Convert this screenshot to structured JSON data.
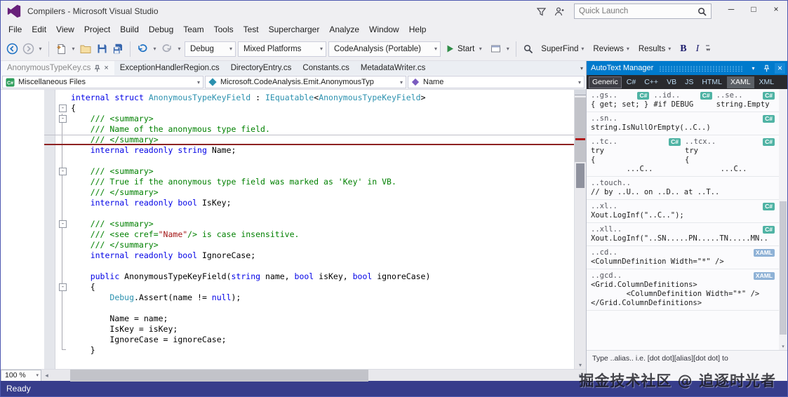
{
  "window": {
    "title": "Compilers - Microsoft Visual Studio"
  },
  "titlebar": {
    "quick_launch_placeholder": "Quick Launch",
    "minimize": "─",
    "maximize": "□",
    "close": "×"
  },
  "icons": {
    "dropdown": "▾",
    "scroll_left": "◂",
    "scroll_right": "▸",
    "scroll_down": "▾",
    "fold_collapse": "-",
    "tab_close": "×",
    "panel_close": "×",
    "window_menu": "▾",
    "overflow": "▾▾"
  },
  "colors": {
    "panel_header": "#007ACC",
    "status_bar": "#373D8B",
    "keyword": "#0000E6",
    "type": "#2B91AF",
    "comment": "#008000",
    "string": "#A31515",
    "badge_csharp": "#4FB3A4",
    "badge_xaml": "#8FB2D6"
  },
  "menubar": {
    "items": [
      "File",
      "Edit",
      "View",
      "Project",
      "Build",
      "Debug",
      "Team",
      "Tools",
      "Test",
      "Supercharger",
      "Analyze",
      "Window",
      "Help"
    ]
  },
  "toolbar": {
    "debug_combo": "Debug",
    "platform_combo": "Mixed Platforms",
    "config_combo": "CodeAnalysis (Portable)",
    "start_label": "Start",
    "superfind_label": "SuperFind",
    "reviews_label": "Reviews",
    "results_label": "Results",
    "bold_label": "B",
    "italic_label": "I"
  },
  "tabbar": {
    "tabs": [
      {
        "label": "AnonymousTypeKey.cs",
        "active": true
      },
      {
        "label": "ExceptionHandlerRegion.cs",
        "active": false
      },
      {
        "label": "DirectoryEntry.cs",
        "active": false
      },
      {
        "label": "Constants.cs",
        "active": false
      },
      {
        "label": "MetadataWriter.cs",
        "active": false
      }
    ]
  },
  "navbar": {
    "project": "Miscellaneous Files",
    "type": "Microsoft.CodeAnalysis.Emit.AnonymousTyp",
    "member": "Name"
  },
  "editor": {
    "zoom": "100 %",
    "lines": [
      {
        "fold": false,
        "caret": false,
        "seg": [
          [
            "kw",
            "internal"
          ],
          [
            "pl",
            " "
          ],
          [
            "kw",
            "struct"
          ],
          [
            "pl",
            " "
          ],
          [
            "ty",
            "AnonymousTypeKeyField"
          ],
          [
            "pl",
            " : "
          ],
          [
            "ty",
            "IEquatable"
          ],
          [
            "pl",
            "<"
          ],
          [
            "ty",
            "AnonymousTypeKeyField"
          ],
          [
            "pl",
            ">"
          ]
        ]
      },
      {
        "fold": true,
        "caret": false,
        "seg": [
          [
            "pl",
            "{"
          ]
        ]
      },
      {
        "fold": true,
        "caret": false,
        "seg": [
          [
            "cm",
            "    /// <summary>"
          ]
        ]
      },
      {
        "fold": false,
        "caret": false,
        "seg": [
          [
            "cm",
            "    /// Name of the anonymous type field."
          ]
        ]
      },
      {
        "fold": false,
        "caret": true,
        "seg": [
          [
            "cm",
            "    /// </summary>"
          ]
        ]
      },
      {
        "fold": false,
        "caret": false,
        "seg": [
          [
            "pl",
            "    "
          ],
          [
            "kw",
            "internal"
          ],
          [
            "pl",
            " "
          ],
          [
            "kw",
            "readonly"
          ],
          [
            "pl",
            " "
          ],
          [
            "kw",
            "string"
          ],
          [
            "pl",
            " Name;"
          ]
        ]
      },
      {
        "fold": false,
        "caret": false,
        "seg": []
      },
      {
        "fold": true,
        "caret": false,
        "seg": [
          [
            "cm",
            "    /// <summary>"
          ]
        ]
      },
      {
        "fold": false,
        "caret": false,
        "seg": [
          [
            "cm",
            "    /// True if the anonymous type field was marked as 'Key' in VB."
          ]
        ]
      },
      {
        "fold": false,
        "caret": false,
        "seg": [
          [
            "cm",
            "    /// </summary>"
          ]
        ]
      },
      {
        "fold": false,
        "caret": false,
        "seg": [
          [
            "pl",
            "    "
          ],
          [
            "kw",
            "internal"
          ],
          [
            "pl",
            " "
          ],
          [
            "kw",
            "readonly"
          ],
          [
            "pl",
            " "
          ],
          [
            "kw",
            "bool"
          ],
          [
            "pl",
            " IsKey;"
          ]
        ]
      },
      {
        "fold": false,
        "caret": false,
        "seg": []
      },
      {
        "fold": true,
        "caret": false,
        "seg": [
          [
            "cm",
            "    /// <summary>"
          ]
        ]
      },
      {
        "fold": false,
        "caret": false,
        "seg": [
          [
            "cm",
            "    /// <see cref="
          ],
          [
            "st",
            "\"Name\""
          ],
          [
            "cm",
            "/> is case insensitive."
          ]
        ]
      },
      {
        "fold": false,
        "caret": false,
        "seg": [
          [
            "cm",
            "    /// </summary>"
          ]
        ]
      },
      {
        "fold": false,
        "caret": false,
        "seg": [
          [
            "pl",
            "    "
          ],
          [
            "kw",
            "internal"
          ],
          [
            "pl",
            " "
          ],
          [
            "kw",
            "readonly"
          ],
          [
            "pl",
            " "
          ],
          [
            "kw",
            "bool"
          ],
          [
            "pl",
            " IgnoreCase;"
          ]
        ]
      },
      {
        "fold": false,
        "caret": false,
        "seg": []
      },
      {
        "fold": false,
        "caret": false,
        "seg": [
          [
            "pl",
            "    "
          ],
          [
            "kw",
            "public"
          ],
          [
            "pl",
            " AnonymousTypeKeyField("
          ],
          [
            "kw",
            "string"
          ],
          [
            "pl",
            " name, "
          ],
          [
            "kw",
            "bool"
          ],
          [
            "pl",
            " isKey, "
          ],
          [
            "kw",
            "bool"
          ],
          [
            "pl",
            " ignoreCase)"
          ]
        ]
      },
      {
        "fold": true,
        "caret": false,
        "seg": [
          [
            "pl",
            "    {"
          ]
        ]
      },
      {
        "fold": false,
        "caret": false,
        "seg": [
          [
            "pl",
            "        "
          ],
          [
            "ty",
            "Debug"
          ],
          [
            "pl",
            ".Assert(name != "
          ],
          [
            "kw",
            "null"
          ],
          [
            "pl",
            ");"
          ]
        ]
      },
      {
        "fold": false,
        "caret": false,
        "seg": []
      },
      {
        "fold": false,
        "caret": false,
        "seg": [
          [
            "pl",
            "        Name = name;"
          ]
        ]
      },
      {
        "fold": false,
        "caret": false,
        "seg": [
          [
            "pl",
            "        IsKey = isKey;"
          ]
        ]
      },
      {
        "fold": false,
        "caret": false,
        "seg": [
          [
            "pl",
            "        IgnoreCase = ignoreCase;"
          ]
        ]
      },
      {
        "fold": false,
        "caret": false,
        "seg": [
          [
            "pl",
            "    }"
          ]
        ]
      }
    ]
  },
  "panel": {
    "title": "AutoText Manager",
    "tabs": [
      "Generic",
      "C#",
      "C++",
      "VB",
      "JS",
      "HTML",
      "XAML",
      "XML"
    ],
    "active_tab": "Generic",
    "highlight_tab": "XAML",
    "rows": [
      {
        "cells": [
          {
            "alias": "..gs..",
            "badge": "C#",
            "badge_type": "cs",
            "lines": [
              "{ get; set; }"
            ]
          },
          {
            "alias": "..id..",
            "badge": "C#",
            "badge_type": "cs",
            "lines": [
              "#if DEBUG"
            ]
          },
          {
            "alias": "..se..",
            "badge": "C#",
            "badge_type": "cs",
            "lines": [
              "string.Empty"
            ]
          }
        ]
      },
      {
        "cells": [
          {
            "alias": "..sn..",
            "badge": "C#",
            "badge_type": "cs",
            "lines": [
              "string.IsNullOrEmpty(..C..)"
            ]
          }
        ]
      },
      {
        "cells": [
          {
            "alias": "..tc..",
            "badge": "C#",
            "badge_type": "cs",
            "lines": [
              "try",
              "{",
              "        ...C.."
            ]
          },
          {
            "alias": "..tcx..",
            "badge": "C#",
            "badge_type": "cs",
            "lines": [
              "try",
              "{",
              "        ...C.."
            ]
          }
        ]
      },
      {
        "cells": [
          {
            "alias": "..touch..",
            "badge": "",
            "badge_type": "",
            "lines": [
              "// by ..U.. on ..D.. at ..T.."
            ]
          }
        ]
      },
      {
        "cells": [
          {
            "alias": "..xl..",
            "badge": "C#",
            "badge_type": "cs",
            "lines": [
              "Xout.LogInf(\"..C..\");"
            ]
          }
        ]
      },
      {
        "cells": [
          {
            "alias": "..xll..",
            "badge": "C#",
            "badge_type": "cs",
            "lines": [
              "Xout.LogInf(\"..SN.....PN.....TN.....MN.."
            ]
          }
        ]
      },
      {
        "cells": [
          {
            "alias": "..cd..",
            "badge": "XAML",
            "badge_type": "xaml",
            "lines": [
              "<ColumnDefinition Width=\"*\" />"
            ]
          }
        ]
      },
      {
        "cells": [
          {
            "alias": "..gcd..",
            "badge": "XAML",
            "badge_type": "xaml",
            "lines": [
              "<Grid.ColumnDefinitions>",
              "        <ColumnDefinition Width=\"*\" />",
              "</Grid.ColumnDefinitions>"
            ]
          }
        ]
      }
    ],
    "help": "Type ..alias.. i.e. [dot dot][alias][dot dot] to"
  },
  "statusbar": {
    "text": "Ready"
  },
  "watermark": "掘金技术社区 @ 追逐时光者"
}
